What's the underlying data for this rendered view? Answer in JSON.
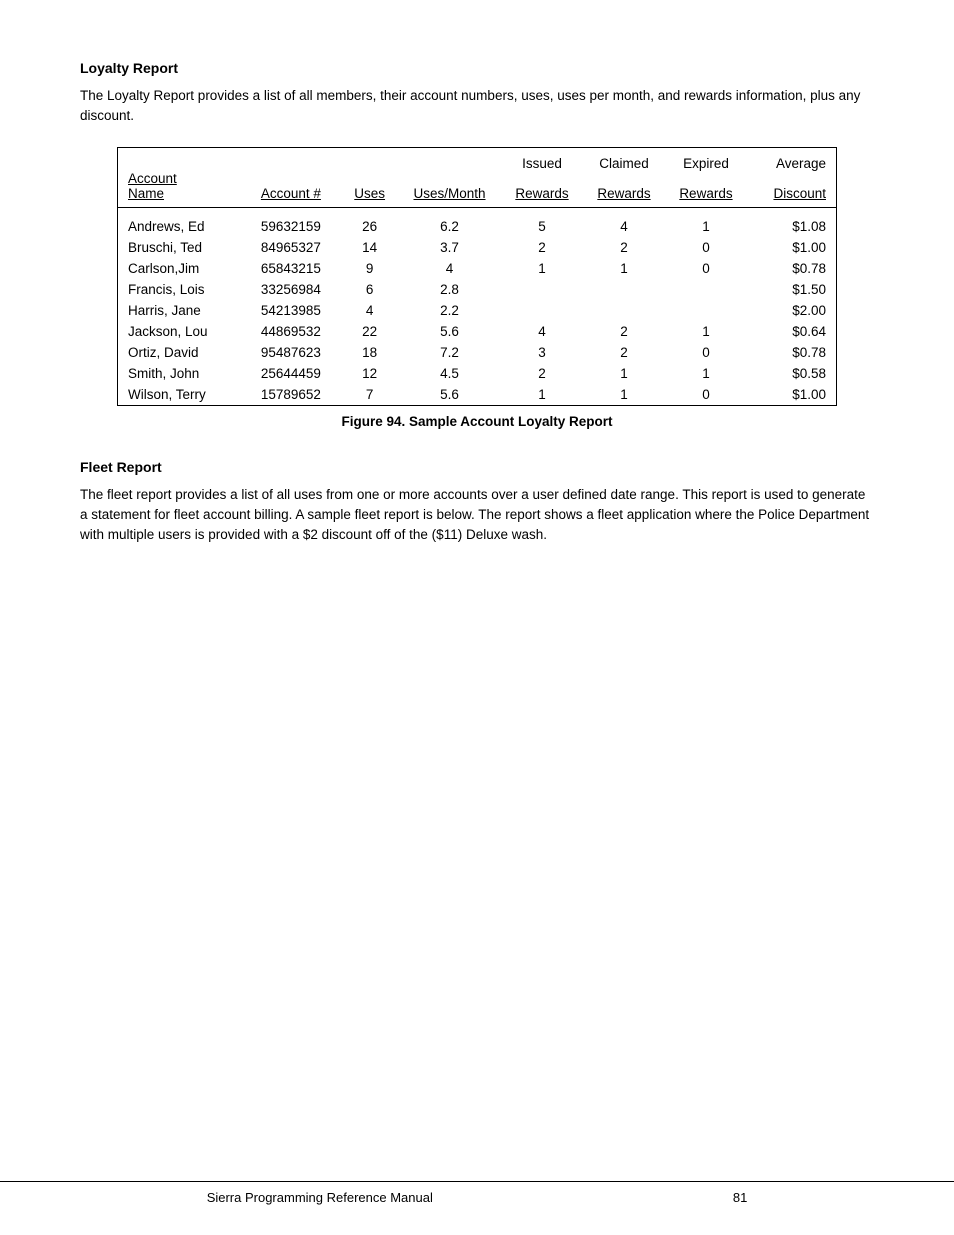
{
  "loyalty_report": {
    "title": "Loyalty Report",
    "description": "The Loyalty Report provides a list of all members, their account numbers, uses, uses per month, and rewards information, plus any discount.",
    "table": {
      "header_top": {
        "col1": "",
        "col2": "",
        "col3": "",
        "col4": "",
        "col5": "Issued",
        "col6": "Claimed",
        "col7": "Expired",
        "col8": "Average"
      },
      "header_bottom": {
        "col1_line1": "Account",
        "col1_line2": "Name",
        "col2": "Account #",
        "col3": "Uses",
        "col4": "Uses/Month",
        "col5": "Rewards",
        "col6": "Rewards",
        "col7": "Rewards",
        "col8": "Discount"
      },
      "rows": [
        {
          "name": "Andrews, Ed",
          "account": "59632159",
          "uses": "26",
          "per_month": "6.2",
          "issued": "5",
          "claimed": "4",
          "expired": "1",
          "discount": "$1.08"
        },
        {
          "name": "Bruschi, Ted",
          "account": "84965327",
          "uses": "14",
          "per_month": "3.7",
          "issued": "2",
          "claimed": "2",
          "expired": "0",
          "discount": "$1.00"
        },
        {
          "name": "Carlson,Jim",
          "account": "65843215",
          "uses": "9",
          "per_month": "4",
          "issued": "1",
          "claimed": "1",
          "expired": "0",
          "discount": "$0.78"
        },
        {
          "name": "Francis, Lois",
          "account": "33256984",
          "uses": "6",
          "per_month": "2.8",
          "issued": "",
          "claimed": "",
          "expired": "",
          "discount": "$1.50"
        },
        {
          "name": "Harris, Jane",
          "account": "54213985",
          "uses": "4",
          "per_month": "2.2",
          "issued": "",
          "claimed": "",
          "expired": "",
          "discount": "$2.00"
        },
        {
          "name": "Jackson, Lou",
          "account": "44869532",
          "uses": "22",
          "per_month": "5.6",
          "issued": "4",
          "claimed": "2",
          "expired": "1",
          "discount": "$0.64"
        },
        {
          "name": "Ortiz, David",
          "account": "95487623",
          "uses": "18",
          "per_month": "7.2",
          "issued": "3",
          "claimed": "2",
          "expired": "0",
          "discount": "$0.78"
        },
        {
          "name": "Smith, John",
          "account": "25644459",
          "uses": "12",
          "per_month": "4.5",
          "issued": "2",
          "claimed": "1",
          "expired": "1",
          "discount": "$0.58"
        },
        {
          "name": "Wilson, Terry",
          "account": "15789652",
          "uses": "7",
          "per_month": "5.6",
          "issued": "1",
          "claimed": "1",
          "expired": "0",
          "discount": "$1.00"
        }
      ]
    },
    "figure_caption": "Figure 94. Sample Account Loyalty Report"
  },
  "fleet_report": {
    "title": "Fleet Report",
    "description": "The fleet report provides a list of all uses from one or more accounts over a user defined date range. This report is used to generate a statement for fleet account billing. A sample fleet report is below. The report shows a fleet application where the Police Department with multiple users is provided with a $2 discount off of the ($11) Deluxe wash."
  },
  "footer": {
    "manual_name": "Sierra Programming Reference Manual",
    "page_number": "81"
  }
}
